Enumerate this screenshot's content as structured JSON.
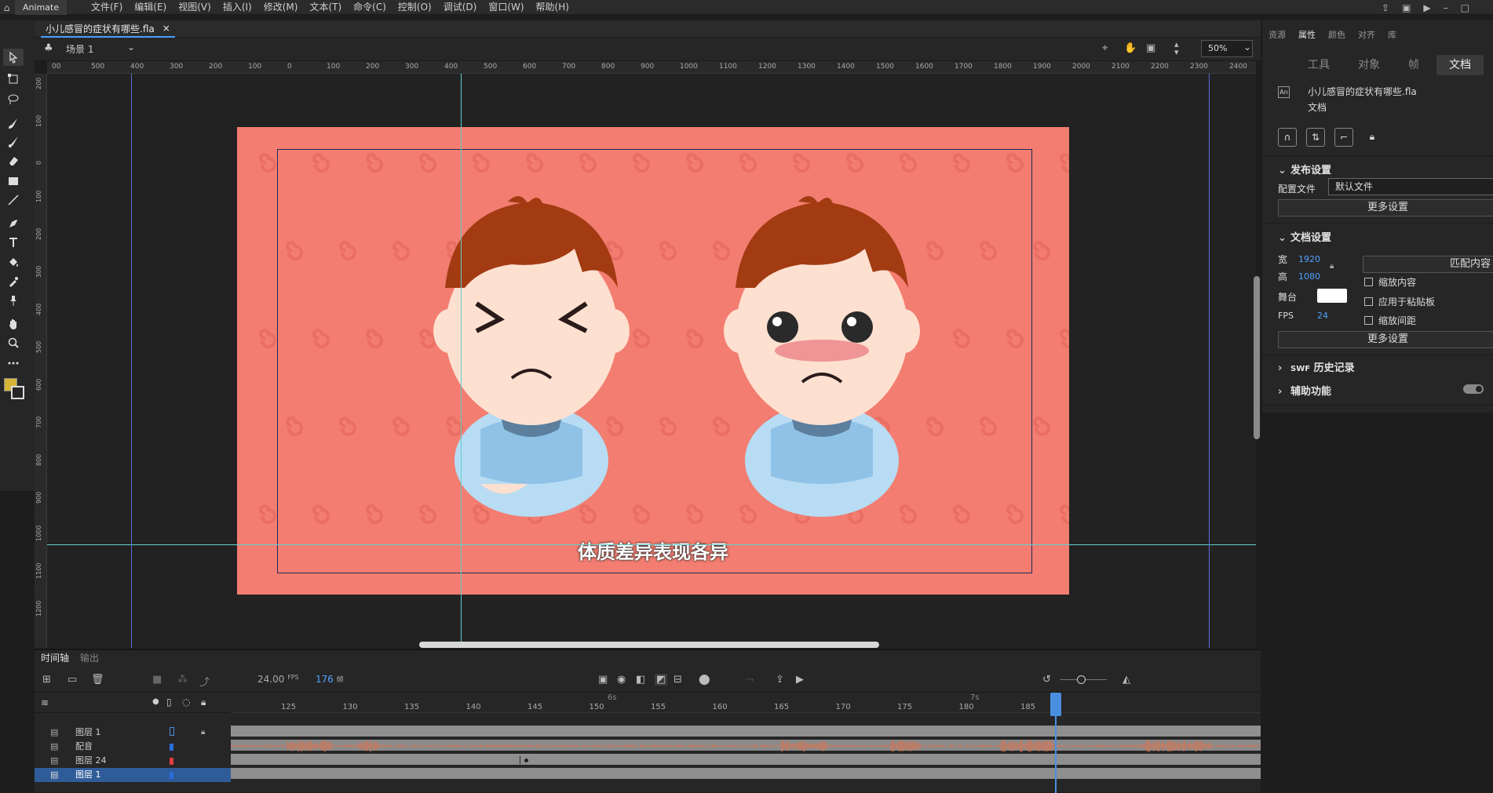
{
  "menubar": {
    "app_name": "Animate",
    "items": [
      "文件(F)",
      "编辑(E)",
      "视图(V)",
      "插入(I)",
      "修改(M)",
      "文本(T)",
      "命令(C)",
      "控制(O)",
      "调试(D)",
      "窗口(W)",
      "帮助(H)"
    ]
  },
  "document": {
    "tab_title": "小儿感冒的症状有哪些.fla",
    "close": "×",
    "scene": "场景 1",
    "zoom": "50%"
  },
  "rulers": {
    "top": [
      "00",
      "500",
      "400",
      "300",
      "200",
      "100",
      "0",
      "100",
      "200",
      "300",
      "400",
      "500",
      "600",
      "700",
      "800",
      "900",
      "1000",
      "1100",
      "1200",
      "1300",
      "1400",
      "1500",
      "1600",
      "1700",
      "1800",
      "1900",
      "2000",
      "2100",
      "2200",
      "2300",
      "2400"
    ],
    "left": [
      "200",
      "100",
      "0",
      "100",
      "200",
      "300",
      "400",
      "500",
      "600",
      "700",
      "800",
      "900",
      "1000",
      "1100",
      "1200"
    ]
  },
  "stage": {
    "subtitle": "体质差异表现各异",
    "background": "#f27d70"
  },
  "properties": {
    "panel_tabs": [
      "资源",
      "属性",
      "颜色",
      "对齐",
      "库"
    ],
    "active_panel_tab": "属性",
    "sub_tabs": [
      "工具",
      "对象",
      "帧",
      "文档"
    ],
    "active_sub_tab": "文档",
    "doc_icon": "An",
    "file_name": "小儿感冒的症状有哪些.fla",
    "file_type": "文档",
    "publish": {
      "title": "发布设置",
      "profile_label": "配置文件",
      "profile_value": "默认文件",
      "more": "更多设置"
    },
    "doc_settings": {
      "title": "文档设置",
      "width_label": "宽",
      "width": "1920",
      "height_label": "高",
      "height": "1080",
      "match_button": "匹配内容",
      "scale_content": "缩放内容",
      "stage_label": "舞台",
      "apply_pasteboard": "应用于粘贴板",
      "fps_label": "FPS",
      "fps": "24",
      "scale_spacing": "缩放间距",
      "more": "更多设置"
    },
    "swf_history": {
      "prefix": "SWF",
      "title": "历史记录"
    },
    "accessibility": "辅助功能"
  },
  "timeline": {
    "tabs": [
      "时间轴",
      "输出"
    ],
    "fps": "24.00",
    "fps_unit": "FPS",
    "current_frame": "176",
    "frame_unit": "帧",
    "ruler_marks": [
      "6s",
      "7s"
    ],
    "frame_numbers": [
      "125",
      "130",
      "135",
      "140",
      "145",
      "150",
      "155",
      "160",
      "165",
      "170",
      "175",
      "180",
      "185"
    ],
    "layers": [
      {
        "name": "图层 1",
        "color": "#2b6cdb",
        "selected": false
      },
      {
        "name": "配音",
        "color": "#2b6cdb",
        "selected": false
      },
      {
        "name": "图层 24",
        "color": "#e03c3c",
        "selected": false
      },
      {
        "name": "图层 1",
        "color": "#2b6cdb",
        "selected": true
      }
    ]
  }
}
